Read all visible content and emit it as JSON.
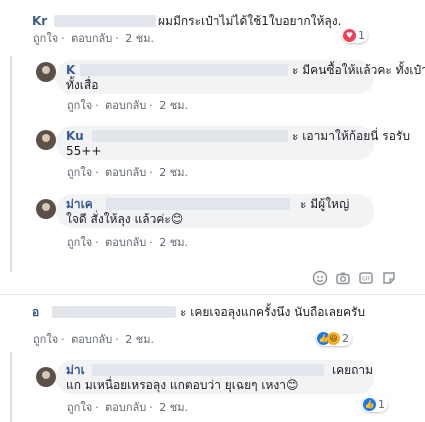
{
  "colors": {
    "name": "#385898",
    "bubble": "#f2f3f5",
    "meta": "#606770",
    "love": "#f33e58",
    "like": "#1877f2"
  },
  "labels": {
    "like": "ถูกใจ",
    "reply": "ตอบกลับ",
    "dot": "·"
  },
  "comments": [
    {
      "name": "Kr",
      "text": "ผมมีกระเป๋าไม่ได้ใช้1ใบอยากให้ลุง.",
      "time": "2 ชม.",
      "reaction_count": "1"
    },
    {
      "name": "K",
      "text_end": "ะ มีคนซื้อให้แล้วคะ ทั้งเป๋า",
      "text2": "ทั้งเสื่อ",
      "time": "2 ชม."
    },
    {
      "name": "Ku",
      "text_end": "ะ เอามาให้ก้อยนี่ รอรับ",
      "text2": "55++",
      "time": "2 ชม."
    },
    {
      "name": "ม่าเค",
      "text_end": "ะ มีผู้ใหญ่",
      "text2": "ใจดี สั่งให้ลุง แล้วค่ะ😊",
      "time": "2 ชม."
    },
    {
      "name": "อ",
      "text_end": "ะ เคยเจอลุงแกครั้งนึง นับถือเลยครับ",
      "time": "2 ชม.",
      "reaction_count": "2"
    },
    {
      "name": "ม่าเ",
      "text_end": "เคยถาม",
      "text2": "แก มเหนื่อยเหรอลุง แกตอบว่า ยุเฉยๆ เหงา😊",
      "time": "2 ชม.",
      "reaction_count": "1"
    }
  ],
  "toolbar_icons": [
    "emoji-icon",
    "camera-icon",
    "gif-icon",
    "sticker-icon"
  ]
}
